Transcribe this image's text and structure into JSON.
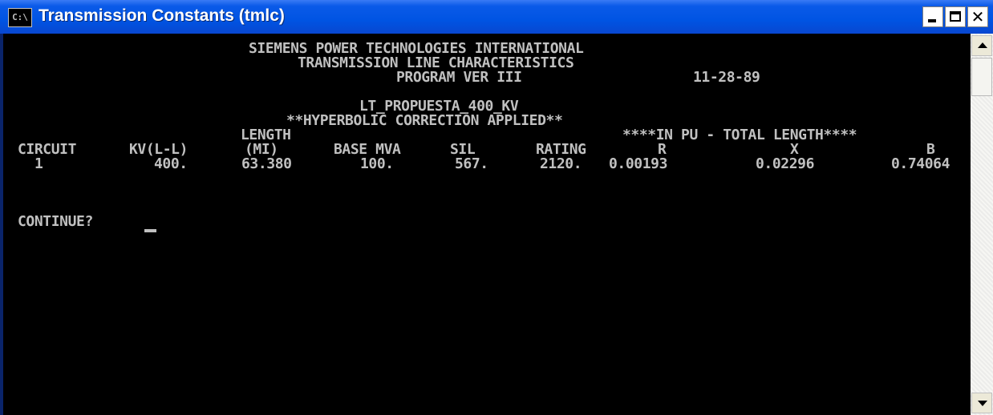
{
  "window": {
    "title": "Transmission Constants (tmlc)",
    "icon": "console-icon",
    "icon_text": "C:\\",
    "controls": {
      "minimize": "minimize-icon",
      "maximize": "maximize-icon",
      "close": "close-icon",
      "close_glyph": "✕"
    }
  },
  "console": {
    "header": [
      "SIEMENS POWER TECHNOLOGIES INTERNATIONAL",
      "TRANSMISSION LINE CHARACTERISTICS",
      "PROGRAM VER III",
      "11-28-89"
    ],
    "case_name": "LT_PROPUESTA_400_KV",
    "correction_note": "**HYPERBOLIC CORRECTION APPLIED**",
    "table": {
      "group_header": "****IN PU - TOTAL LENGTH****",
      "header_row1": [
        "LENGTH"
      ],
      "columns": [
        "CIRCUIT",
        "KV(L-L)",
        "(MI)",
        "BASE MVA",
        "SIL",
        "RATING",
        "R",
        "X",
        "B"
      ],
      "rows": [
        [
          "1",
          "400.",
          "63.380",
          "100.",
          "567.",
          "2120.",
          "0.00193",
          "0.02296",
          "0.74064"
        ]
      ]
    },
    "prompt": "CONTINUE?"
  },
  "colors": {
    "title_bar": "#0054e3",
    "console_bg": "#000000",
    "console_text": "#c0c0c0"
  }
}
